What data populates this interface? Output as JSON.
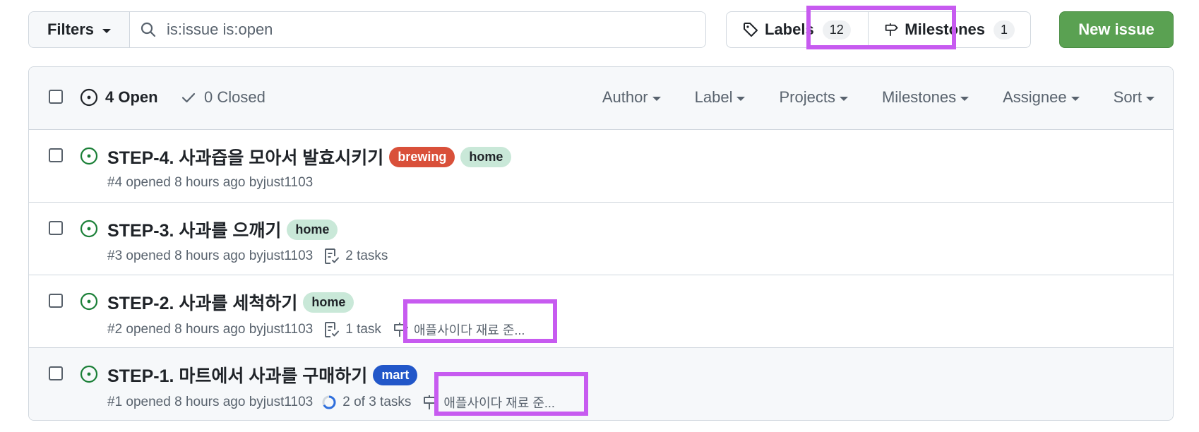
{
  "toolbar": {
    "filters_label": "Filters",
    "search_value": "is:issue is:open",
    "labels_label": "Labels",
    "labels_count": "12",
    "milestones_label": "Milestones",
    "milestones_count": "1",
    "new_issue_label": "New issue"
  },
  "header": {
    "open_label": "4 Open",
    "closed_label": "0 Closed",
    "filters": [
      "Author",
      "Label",
      "Projects",
      "Milestones",
      "Assignee",
      "Sort"
    ]
  },
  "issues": [
    {
      "title": "STEP-4. 사과즙을 모아서 발효시키기",
      "labels": [
        {
          "text": "brewing",
          "bg": "#d9503a",
          "fg": "#ffffff"
        },
        {
          "text": "home",
          "bg": "#c9e8d8",
          "fg": "#1f2328"
        }
      ],
      "opened": "#4 opened 8 hours ago by ",
      "author": "just1103",
      "tasks": "",
      "milestone": ""
    },
    {
      "title": "STEP-3. 사과를 으깨기",
      "labels": [
        {
          "text": "home",
          "bg": "#c9e8d8",
          "fg": "#1f2328"
        }
      ],
      "opened": "#3 opened 8 hours ago by ",
      "author": "just1103",
      "tasks": "2 tasks",
      "milestone": ""
    },
    {
      "title": "STEP-2. 사과를 세척하기",
      "labels": [
        {
          "text": "home",
          "bg": "#c9e8d8",
          "fg": "#1f2328"
        }
      ],
      "opened": "#2 opened 8 hours ago by ",
      "author": "just1103",
      "tasks": "1 task",
      "milestone": "애플사이다 재료 준..."
    },
    {
      "title": "STEP-1. 마트에서 사과를 구매하기",
      "labels": [
        {
          "text": "mart",
          "bg": "#2257c9",
          "fg": "#ffffff"
        }
      ],
      "opened": "#1 opened 8 hours ago by ",
      "author": "just1103",
      "tasks": "2 of 3 tasks",
      "task_progress": 0.667,
      "milestone": "애플사이다 재료 준..."
    }
  ],
  "colors": {
    "open_green": "#1a7f37",
    "highlight": "#c75bf0",
    "primary_button": "#5aa152"
  }
}
